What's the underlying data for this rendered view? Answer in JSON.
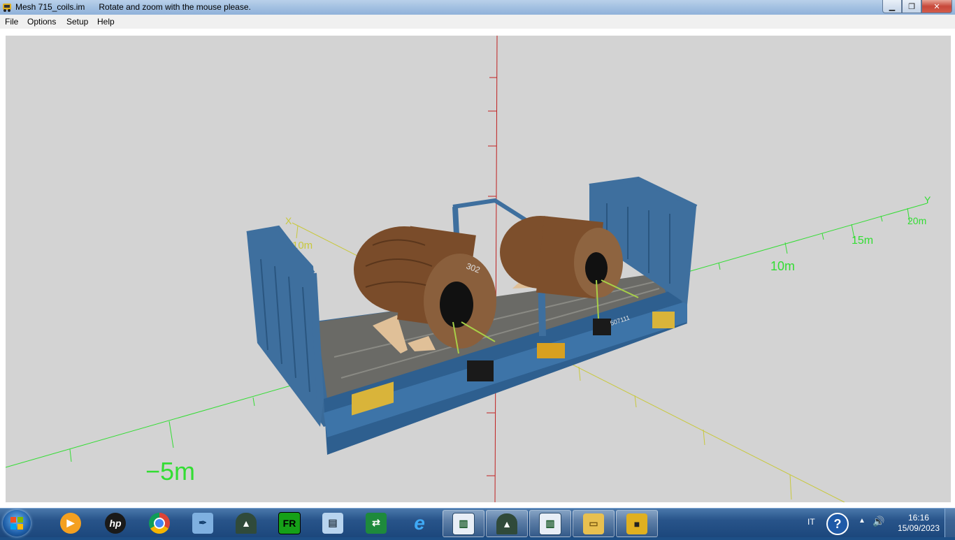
{
  "window": {
    "title": "Mesh 715_coils.im",
    "hint": "Rotate and zoom with the mouse please.",
    "minimize": "▁",
    "maximize": "❐",
    "close": "✕"
  },
  "menu": [
    "File",
    "Options",
    "Setup",
    "Help"
  ],
  "scene": {
    "axis_x_label": "X",
    "axis_y_label": "Y",
    "x_tick_10": "10m",
    "y_ticks": [
      "10m",
      "15m",
      "20m"
    ],
    "neg_label": "−5m",
    "coil_number": "302",
    "wagon_number": "507111"
  },
  "colors": {
    "scene_bg": "#d3d3d3",
    "axis_y_green": "#33dd33",
    "axis_x_yellow": "#c8c83c",
    "axis_z_red": "#c02020",
    "wagon_blue": "#3e6f9e",
    "coil_rust": "#8a5a34"
  },
  "taskbar": {
    "items": [
      {
        "name": "media-player-icon",
        "open": false
      },
      {
        "name": "hp-icon",
        "open": false
      },
      {
        "name": "chrome-icon",
        "open": false
      },
      {
        "name": "quill-icon",
        "open": false
      },
      {
        "name": "tunnel-app-icon",
        "open": false
      },
      {
        "name": "far-icon",
        "open": false
      },
      {
        "name": "notepad-icon",
        "open": false
      },
      {
        "name": "transfer-icon",
        "open": false
      },
      {
        "name": "ie-icon",
        "open": false
      },
      {
        "name": "window-app-icon",
        "open": true
      },
      {
        "name": "tunnel-app-icon-2",
        "open": true
      },
      {
        "name": "window-app-icon-2",
        "open": true
      },
      {
        "name": "explorer-icon",
        "open": true
      },
      {
        "name": "train-app-icon",
        "open": true
      }
    ],
    "language": "IT",
    "time": "16:16",
    "date": "15/09/2023"
  }
}
